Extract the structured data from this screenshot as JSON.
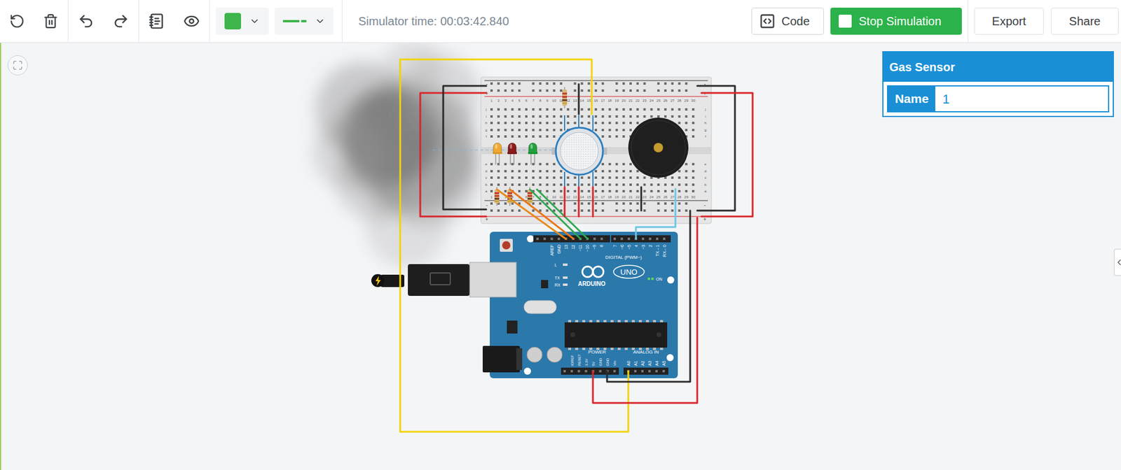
{
  "toolbar": {
    "wire_color": "#3db54a",
    "simulator_time": "Simulator time: 00:03:42.840",
    "buttons": [
      {
        "label": "Code",
        "kind": "outline"
      },
      {
        "label": "Stop Simulation",
        "kind": "primary"
      },
      {
        "label": "Export",
        "kind": "plain"
      },
      {
        "label": "Share",
        "kind": "plain"
      }
    ]
  },
  "inspector": {
    "title": "Gas Sensor",
    "fields": [
      {
        "label": "Name",
        "value": "1"
      }
    ]
  },
  "breadboard": {
    "columns": [
      "1",
      "2",
      "3",
      "4",
      "5",
      "6",
      "7",
      "8",
      "9",
      "10",
      "11",
      "12",
      "13",
      "14",
      "15",
      "16",
      "17",
      "18",
      "19",
      "20",
      "21",
      "22",
      "23",
      "24",
      "25",
      "26",
      "27",
      "28",
      "29",
      "30"
    ],
    "upper_rows": [
      "j",
      "i",
      "h",
      "g",
      "f"
    ],
    "lower_rows": [
      "e",
      "d",
      "c",
      "b",
      "a"
    ],
    "rail_signs": [
      "-",
      "+"
    ]
  },
  "leds": [
    {
      "color": "#f0a830"
    },
    {
      "color": "#8c1c1c"
    },
    {
      "color": "#23a03c"
    }
  ],
  "arduino": {
    "brand": "ARDUINO",
    "model": "UNO",
    "digital_header": "DIGITAL (PWM~)",
    "digital_pins": [
      "AREF",
      "GND",
      "13",
      "12",
      "~11",
      "~10",
      "~9",
      "8",
      "7",
      "~6",
      "~5",
      "4",
      "~3",
      "2",
      "TX→1",
      "RX←0"
    ],
    "power_header": "POWER",
    "power_pins": [
      "IOREF",
      "RESET",
      "3.3V",
      "5V",
      "GND",
      "GND",
      "Vin"
    ],
    "analog_header": "ANALOG IN",
    "analog_pins": [
      "A0",
      "A1",
      "A2",
      "A3",
      "A4",
      "A5"
    ],
    "board_leds": [
      "L",
      "TX",
      "RX"
    ],
    "on_label": "ON"
  }
}
